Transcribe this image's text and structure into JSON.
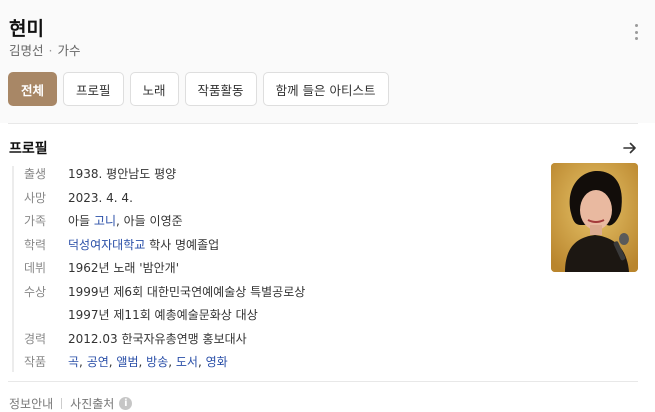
{
  "header": {
    "title": "현미",
    "subtitle_name": "김명선",
    "subtitle_separator": "·",
    "subtitle_role": "가수",
    "more_icon": "more-vertical-icon"
  },
  "tabs": [
    {
      "label": "전체",
      "active": true
    },
    {
      "label": "프로필",
      "active": false
    },
    {
      "label": "노래",
      "active": false
    },
    {
      "label": "작품활동",
      "active": false
    },
    {
      "label": "함께 들은 아티스트",
      "active": false
    }
  ],
  "profile": {
    "title": "프로필",
    "arrow_icon": "arrow-right-icon",
    "rows": {
      "birth": {
        "label": "출생",
        "value": "1938. 평안남도 평양"
      },
      "death": {
        "label": "사망",
        "value": "2023. 4. 4."
      },
      "family": {
        "label": "가족",
        "prefix": "아들",
        "link": "고니",
        "rest": ", 아들 이영준"
      },
      "education": {
        "label": "학력",
        "link": "덕성여자대학교",
        "rest": " 학사 명예졸업"
      },
      "debut": {
        "label": "데뷔",
        "value": "1962년 노래 '밤안개'"
      },
      "awards": {
        "label": "수상",
        "lines": [
          "1999년 제6회 대한민국연예예술상 특별공로상",
          "1997년 제11회 예총예술문화상 대상"
        ]
      },
      "career": {
        "label": "경력",
        "value": "2012.03 한국자유총연맹 홍보대사"
      },
      "works": {
        "label": "작품",
        "links": [
          "곡",
          "공연",
          "앨범",
          "방송",
          "도서",
          "영화"
        ],
        "separator": ", "
      }
    }
  },
  "footer": {
    "info_label": "정보안내",
    "photo_source_label": "사진출처",
    "info_icon": "info-icon",
    "info_icon_glyph": "i"
  },
  "colors": {
    "active_tab": "#a88766",
    "link": "#2a4fa8",
    "photo_background": "#c99a3a"
  }
}
